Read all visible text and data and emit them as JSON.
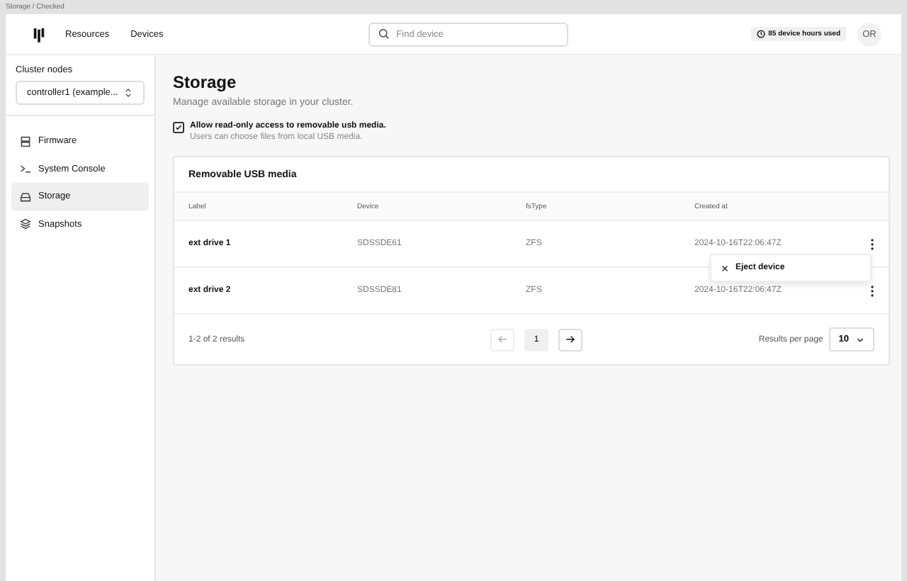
{
  "breadcrumb": "Storage / Checked",
  "header": {
    "nav": [
      {
        "label": "Resources"
      },
      {
        "label": "Devices"
      }
    ],
    "search": {
      "placeholder": "Find device"
    },
    "usage": "85 device hours used",
    "avatar": "OR"
  },
  "sidebar": {
    "cluster_label": "Cluster nodes",
    "cluster_select": "controller1 (example...",
    "items": [
      {
        "label": "Firmware",
        "kind": "firmware",
        "selected": false
      },
      {
        "label": "System Console",
        "kind": "console",
        "selected": false
      },
      {
        "label": "Storage",
        "kind": "storage",
        "selected": true
      },
      {
        "label": "Snapshots",
        "kind": "snapshots",
        "selected": false
      }
    ]
  },
  "page": {
    "title": "Storage",
    "subtitle": "Manage available storage in your cluster.",
    "option": {
      "label": "Allow read-only access to removable usb media.",
      "hint": "Users can choose files from local USB media.",
      "checked": true
    }
  },
  "table": {
    "title": "Removable USB media",
    "columns": [
      "Label",
      "Device",
      "fsType",
      "Created at"
    ],
    "rows": [
      {
        "label": "ext drive 1",
        "device": "SDSSDE61",
        "fstype": "ZFS",
        "created": "2024-10-16T22:06:47Z",
        "menu_open": true
      },
      {
        "label": "ext drive 2",
        "device": "SDSSDE81",
        "fstype": "ZFS",
        "created": "2024-10-16T22:06:47Z",
        "menu_open": false
      }
    ],
    "menu": [
      {
        "label": "Eject device",
        "kind": "close"
      }
    ],
    "footer": {
      "results": "1-2 of 2 results",
      "prev_disabled": true,
      "next_disabled": false,
      "pages": [
        {
          "label": "1",
          "selected": true
        }
      ],
      "per_page_label": "Results per page",
      "per_page": "10"
    }
  }
}
